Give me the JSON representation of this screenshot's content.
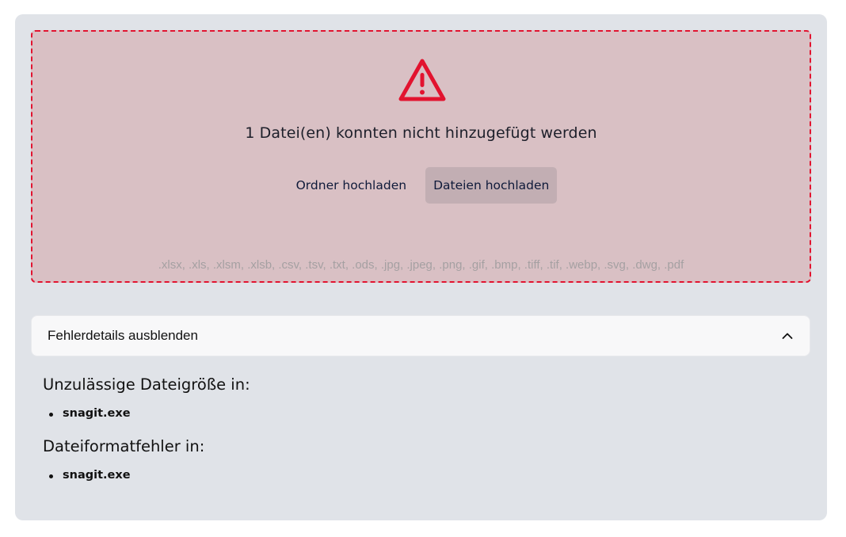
{
  "upload": {
    "error_title": "1 Datei(en) konnten nicht hinzugefügt werden",
    "folder_button": "Ordner hochladen",
    "files_button": "Dateien hochladen",
    "accepted_formats": ".xlsx, .xls, .xlsm, .xlsb, .csv, .tsv, .txt, .ods, .jpg, .jpeg, .png, .gif, .bmp, .tiff, .tif, .webp, .svg, .dwg, .pdf",
    "icon": "warning-triangle-icon",
    "accent_color": "#e2132f"
  },
  "details": {
    "toggle_label": "Fehlerdetails ausblenden",
    "toggle_icon": "chevron-up-icon",
    "sections": [
      {
        "title": "Unzulässige Dateigröße in:",
        "files": [
          "snagit.exe"
        ]
      },
      {
        "title": "Dateiformatfehler in:",
        "files": [
          "snagit.exe"
        ]
      }
    ]
  }
}
